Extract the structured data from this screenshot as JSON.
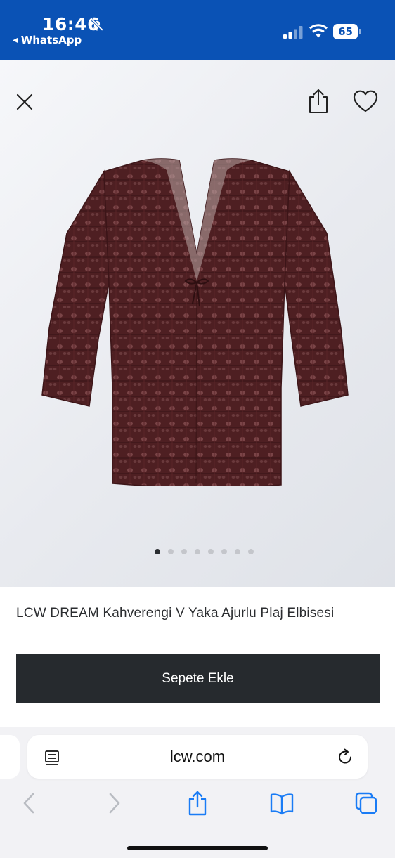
{
  "status_bar": {
    "time": "16:46",
    "back_app": "WhatsApp",
    "battery": "65",
    "icons": [
      "bell-slash-icon",
      "signal-icon",
      "wifi-icon",
      "battery-icon"
    ],
    "background_color": "#0a52b5"
  },
  "gallery": {
    "close_icon": "close-icon",
    "share_icon": "share-icon",
    "favorite_icon": "heart-icon",
    "image_count": 8,
    "active_index": 0,
    "product_color": "#4a1c1f"
  },
  "product": {
    "brand": "LCW DREAM",
    "name": "Kahverengi V Yaka Ajurlu Plaj Elbisesi"
  },
  "cta": {
    "add_to_cart": "Sepete Ekle",
    "color": "#262a2e"
  },
  "browser": {
    "url": "lcw.com",
    "toolbar": [
      "back-icon",
      "forward-icon",
      "share-icon",
      "bookmarks-icon",
      "tabs-icon"
    ],
    "accent_color": "#1a7cf5"
  }
}
